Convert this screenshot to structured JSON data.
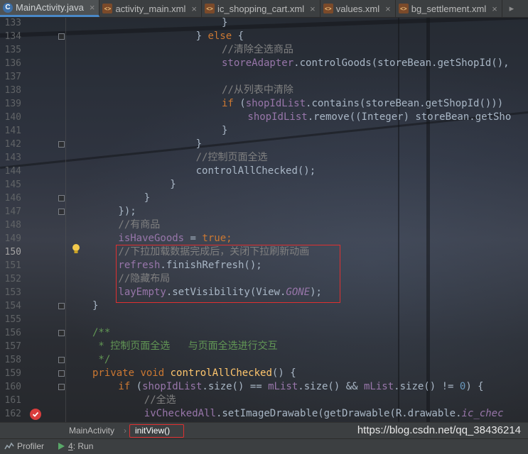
{
  "tabs": [
    {
      "label": "MainActivity.java",
      "type": "java",
      "active": true
    },
    {
      "label": "activity_main.xml",
      "type": "xml",
      "active": false
    },
    {
      "label": "ic_shopping_cart.xml",
      "type": "xml",
      "active": false
    },
    {
      "label": "values.xml",
      "type": "xml",
      "active": false
    },
    {
      "label": "bg_settlement.xml",
      "type": "xml",
      "active": false
    }
  ],
  "code": {
    "current_line": 150,
    "lines": [
      {
        "n": 133,
        "i": 20,
        "t": [
          [
            "p",
            "}"
          ]
        ]
      },
      {
        "n": 134,
        "i": 16,
        "t": [
          [
            "p",
            "} "
          ],
          [
            "k",
            "else"
          ],
          [
            "p",
            " {"
          ]
        ]
      },
      {
        "n": 135,
        "i": 20,
        "t": [
          [
            "c",
            "//清除全选商品"
          ]
        ]
      },
      {
        "n": 136,
        "i": 20,
        "t": [
          [
            "f",
            "storeAdapter"
          ],
          [
            "p",
            ".controlGoods(storeBean.getShopId(),"
          ]
        ]
      },
      {
        "n": 137,
        "i": 0,
        "t": []
      },
      {
        "n": 138,
        "i": 20,
        "t": [
          [
            "c",
            "//从列表中清除"
          ]
        ]
      },
      {
        "n": 139,
        "i": 20,
        "t": [
          [
            "k",
            "if"
          ],
          [
            "p",
            " ("
          ],
          [
            "f",
            "shopIdList"
          ],
          [
            "p",
            ".contains(storeBean.getShopId()))"
          ]
        ]
      },
      {
        "n": 140,
        "i": 24,
        "t": [
          [
            "f",
            "shopIdList"
          ],
          [
            "p",
            ".remove(("
          ],
          [
            "p",
            "Integer"
          ],
          [
            "p",
            ") storeBean.getSho"
          ]
        ]
      },
      {
        "n": 141,
        "i": 20,
        "t": [
          [
            "p",
            "}"
          ]
        ]
      },
      {
        "n": 142,
        "i": 16,
        "t": [
          [
            "p",
            "}"
          ]
        ]
      },
      {
        "n": 143,
        "i": 16,
        "t": [
          [
            "c",
            "//控制页面全选"
          ]
        ]
      },
      {
        "n": 144,
        "i": 16,
        "t": [
          [
            "p",
            "controlAllChecked();"
          ]
        ]
      },
      {
        "n": 145,
        "i": 12,
        "t": [
          [
            "p",
            "}"
          ]
        ]
      },
      {
        "n": 146,
        "i": 8,
        "t": [
          [
            "p",
            "}"
          ]
        ]
      },
      {
        "n": 147,
        "i": 4,
        "t": [
          [
            "p",
            "});"
          ]
        ]
      },
      {
        "n": 148,
        "i": 4,
        "t": [
          [
            "c",
            "//有商品"
          ]
        ]
      },
      {
        "n": 149,
        "i": 4,
        "t": [
          [
            "f",
            "isHaveGoods"
          ],
          [
            "p",
            " = "
          ],
          [
            "k",
            "true"
          ],
          [
            "k",
            ";"
          ]
        ]
      },
      {
        "n": 150,
        "i": 4,
        "t": [
          [
            "c",
            "//下拉加载数据完成后，关闭下拉刷新动画"
          ]
        ]
      },
      {
        "n": 151,
        "i": 4,
        "t": [
          [
            "f",
            "refresh"
          ],
          [
            "p",
            ".finishRefresh();"
          ]
        ]
      },
      {
        "n": 152,
        "i": 4,
        "t": [
          [
            "c",
            "//隐藏布局"
          ]
        ]
      },
      {
        "n": 153,
        "i": 4,
        "t": [
          [
            "f",
            "layEmpty"
          ],
          [
            "p",
            ".setVisibility(View."
          ],
          [
            "fi",
            "GONE"
          ],
          [
            "p",
            ");"
          ]
        ]
      },
      {
        "n": 154,
        "i": 0,
        "t": [
          [
            "p",
            "}"
          ]
        ]
      },
      {
        "n": 155,
        "i": 0,
        "t": []
      },
      {
        "n": 156,
        "i": 0,
        "t": [
          [
            "d",
            "/**"
          ]
        ]
      },
      {
        "n": 157,
        "i": 0,
        "t": [
          [
            "d",
            " * 控制页面全选   与页面全选进行交互"
          ]
        ]
      },
      {
        "n": 158,
        "i": 0,
        "t": [
          [
            "d",
            " */"
          ]
        ]
      },
      {
        "n": 159,
        "i": 0,
        "t": [
          [
            "k",
            "private"
          ],
          [
            "p",
            " "
          ],
          [
            "k",
            "void"
          ],
          [
            "p",
            " "
          ],
          [
            "m",
            "controlAllChecked"
          ],
          [
            "p",
            "() {"
          ]
        ]
      },
      {
        "n": 160,
        "i": 4,
        "t": [
          [
            "k",
            "if"
          ],
          [
            "p",
            " ("
          ],
          [
            "f",
            "shopIdList"
          ],
          [
            "p",
            ".size() == "
          ],
          [
            "f",
            "mList"
          ],
          [
            "p",
            ".size() && "
          ],
          [
            "f",
            "mList"
          ],
          [
            "p",
            ".size() != "
          ],
          [
            "n",
            "0"
          ],
          [
            "p",
            ") {"
          ]
        ]
      },
      {
        "n": 161,
        "i": 8,
        "t": [
          [
            "c",
            "//全选"
          ]
        ]
      },
      {
        "n": 162,
        "i": 8,
        "t": [
          [
            "f",
            "ivCheckedAll"
          ],
          [
            "p",
            ".setImageDrawable(getDrawable(R.drawable."
          ],
          [
            "fi",
            "ic_chec"
          ]
        ]
      }
    ]
  },
  "breadcrumb": [
    "MainActivity",
    "initView()"
  ],
  "watermark": "https://blog.csdn.net/qq_38436214",
  "statusbar": {
    "profiler": "Profiler",
    "run_num": "4",
    "run_label": ": Run"
  },
  "colors": {
    "keyword": "#cc7832",
    "field": "#9876aa",
    "comment": "#808080",
    "doc_comment": "#629755",
    "highlight_border": "#e03030"
  }
}
